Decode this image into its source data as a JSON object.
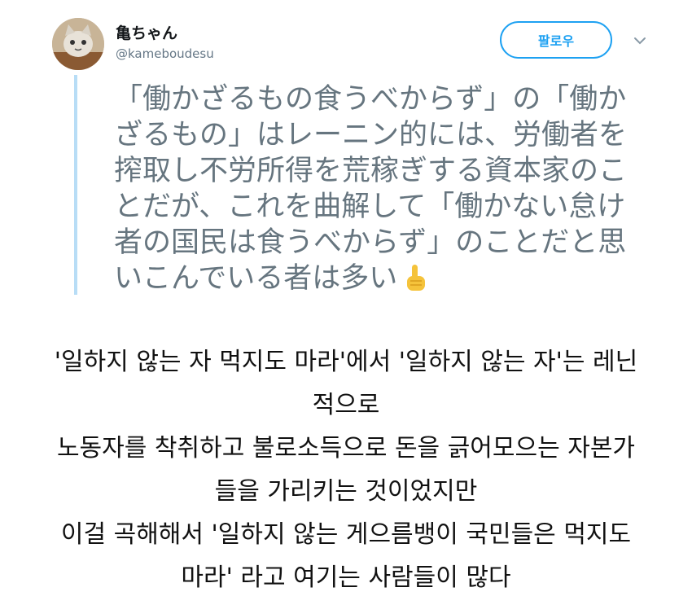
{
  "tweet": {
    "display_name": "亀ちゃん",
    "handle": "@kameboudesu",
    "follow_label": "팔로우",
    "caret_icon": "chevron-down-icon",
    "text_lines": [
      "「働かざるもの食うべからず」の「働か",
      "ざるもの」はレーニン的には、労働者を",
      "搾取し不労所得を荒稼ぎする資本家のこ",
      "とだが、これを曲解して「働かない怠け",
      "者の国民は食うべからず」のことだと思",
      "いこんでいる者は多い"
    ],
    "emoji": "pointing-up-emoji"
  },
  "caption_lines": [
    "'일하지 않는 자 먹지도 마라'에서 '일하지 않는 자'는 레닌",
    "적으로",
    "노동자를 착취하고 불로소득으로 돈을 긁어모으는 자본가",
    "들을 가리키는 것이었지만",
    "이걸 곡해해서 '일하지 않는 게으름뱅이 국민들은 먹지도",
    "마라' 라고 여기는 사람들이 많다"
  ],
  "colors": {
    "accent": "#1da1f2",
    "tweet_text": "#66757f",
    "handle": "#657786",
    "quote_bar": "#b8ddf6"
  }
}
